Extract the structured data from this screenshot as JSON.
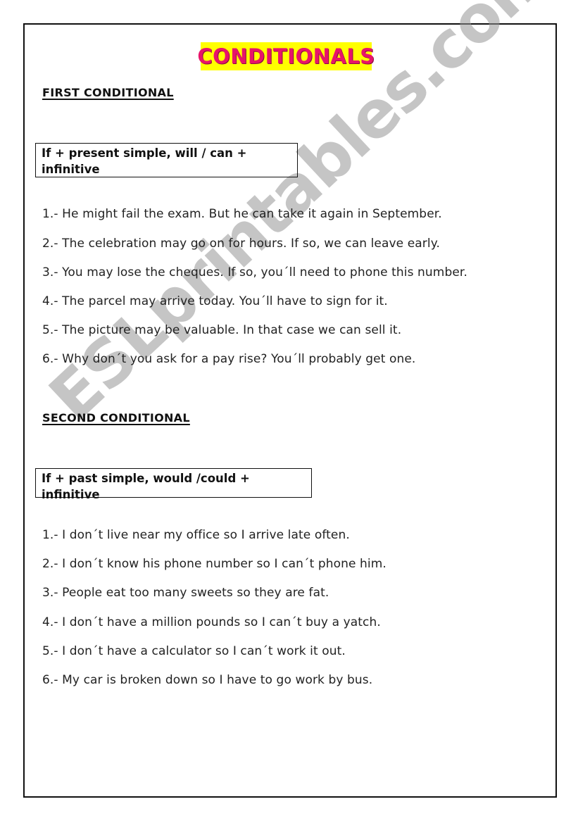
{
  "title": "CONDITIONALS",
  "colors": {
    "title_text": "#e8146a",
    "title_highlight": "#ffff00",
    "watermark": "#a0a0a0"
  },
  "watermark": "ESLprintables.com",
  "sections": [
    {
      "heading": "FIRST CONDITIONAL",
      "formula_line1": "If + present simple, will / can +",
      "formula_line2": "infinitive",
      "sentences": [
        "1.- He might fail the exam. But he can take it again in September.",
        "2.- The celebration may go on for hours. If so, we can leave early.",
        "3.- You may lose the cheques. If so, you´ll need to phone this number.",
        "4.- The parcel may arrive today. You´ll have to sign for it.",
        "5.- The picture may be valuable. In that case we can sell it.",
        "6.- Why don´t you ask for a pay rise? You´ll probably get one."
      ]
    },
    {
      "heading": "SECOND CONDITIONAL",
      "formula_line1": "If + past simple, would /could + infinitive",
      "sentences": [
        "1.- I don´t live near my office so I arrive late often.",
        "2.- I don´t know his phone number so I can´t phone him.",
        "3.- People eat too many sweets so they are fat.",
        "4.- I don´t have a million pounds so I can´t buy a yatch.",
        "5.- I don´t have a calculator so I can´t work it out.",
        "6.- My car is broken down so I have to go work by bus."
      ]
    }
  ]
}
